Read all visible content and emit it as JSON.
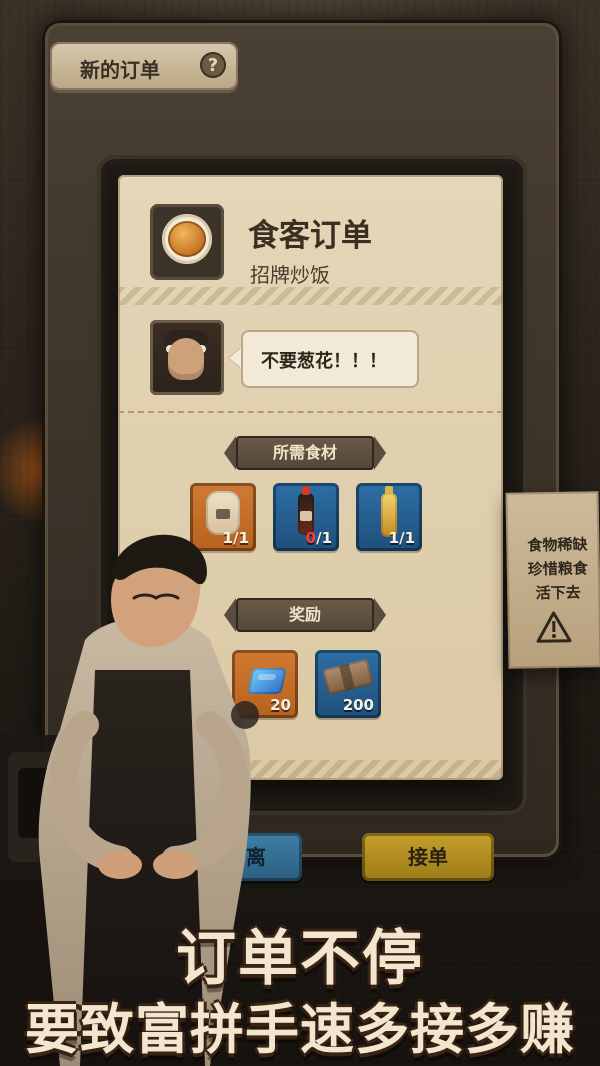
{
  "header": {
    "title": "新的订单",
    "help_icon": "question-mark-icon"
  },
  "order": {
    "title": "食客订单",
    "subtitle": "招牌炒饭",
    "speech": "不要葱花！！！",
    "food_icon": "fried-rice-plate-icon",
    "customer_icon": "chef-avatar-icon"
  },
  "ingredients": {
    "label": "所需食材",
    "items": [
      {
        "icon": "rice-bag-icon",
        "have": "1",
        "need": "1",
        "style": "orange"
      },
      {
        "icon": "soy-sauce-bottle-icon",
        "have": "0",
        "need": "1",
        "style": "blue",
        "have_color": "#ff3b2f"
      },
      {
        "icon": "oil-bottle-icon",
        "have": "1",
        "need": "1",
        "style": "blue"
      }
    ]
  },
  "rewards": {
    "label": "奖励",
    "items": [
      {
        "icon": "blue-gem-icon",
        "value": "20",
        "style": "orange"
      },
      {
        "icon": "cash-bundle-icon",
        "value": "200",
        "style": "blue"
      }
    ]
  },
  "buttons": {
    "leave": "离",
    "accept": "接单"
  },
  "note": {
    "line1": "食物稀缺",
    "line2": "珍惜粮食",
    "line3": "活下去",
    "icon": "warning-triangle-icon"
  },
  "promo": {
    "line1": "订单不停",
    "line2": "要致富拼手速多接多赚"
  }
}
